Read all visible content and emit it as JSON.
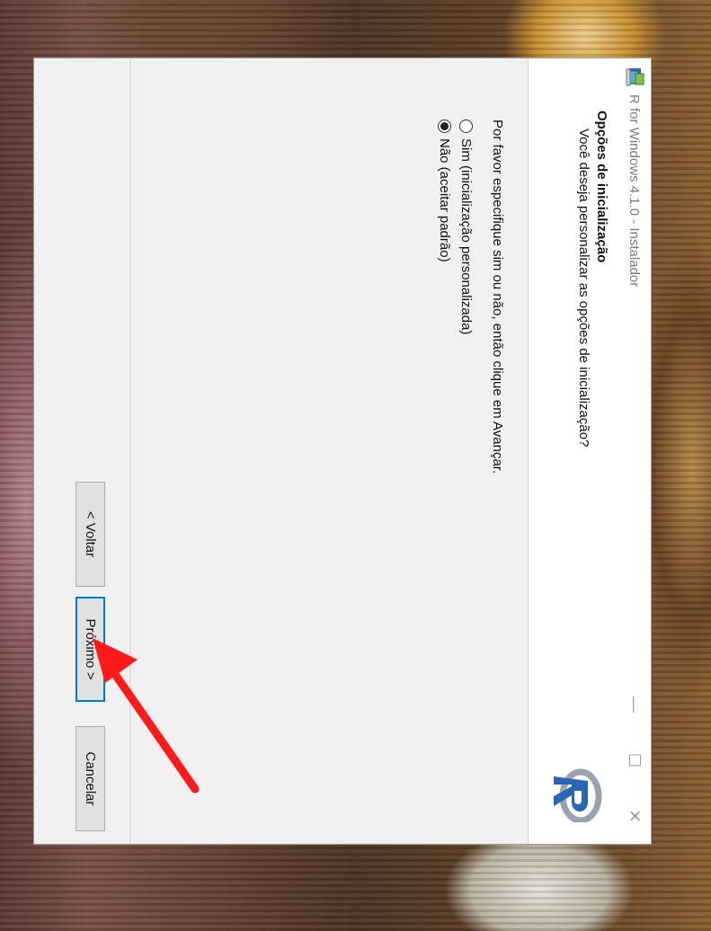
{
  "window": {
    "title": "R for Windows 4.1.0 - Instalador",
    "minimize_symbol": "—",
    "maximize_symbol": "☐",
    "close_symbol": "✕",
    "app_icon": "installer-icon"
  },
  "header": {
    "title": "Opções de inicialização",
    "subtitle": "Você deseja personalizar as opções de inicialização?",
    "logo": "r-logo"
  },
  "content": {
    "instruction": "Por favor especifique sim ou não, então clique em Avançar.",
    "options": [
      {
        "label": "Sim (inicialização personalizada)",
        "checked": false
      },
      {
        "label": "Não (aceitar padrão)",
        "checked": true
      }
    ]
  },
  "buttons": {
    "back": "< Voltar",
    "next": "Próximo >",
    "cancel": "Cancelar"
  },
  "colors": {
    "accent": "#0078d7",
    "annotation_arrow": "#ff1a1a"
  }
}
